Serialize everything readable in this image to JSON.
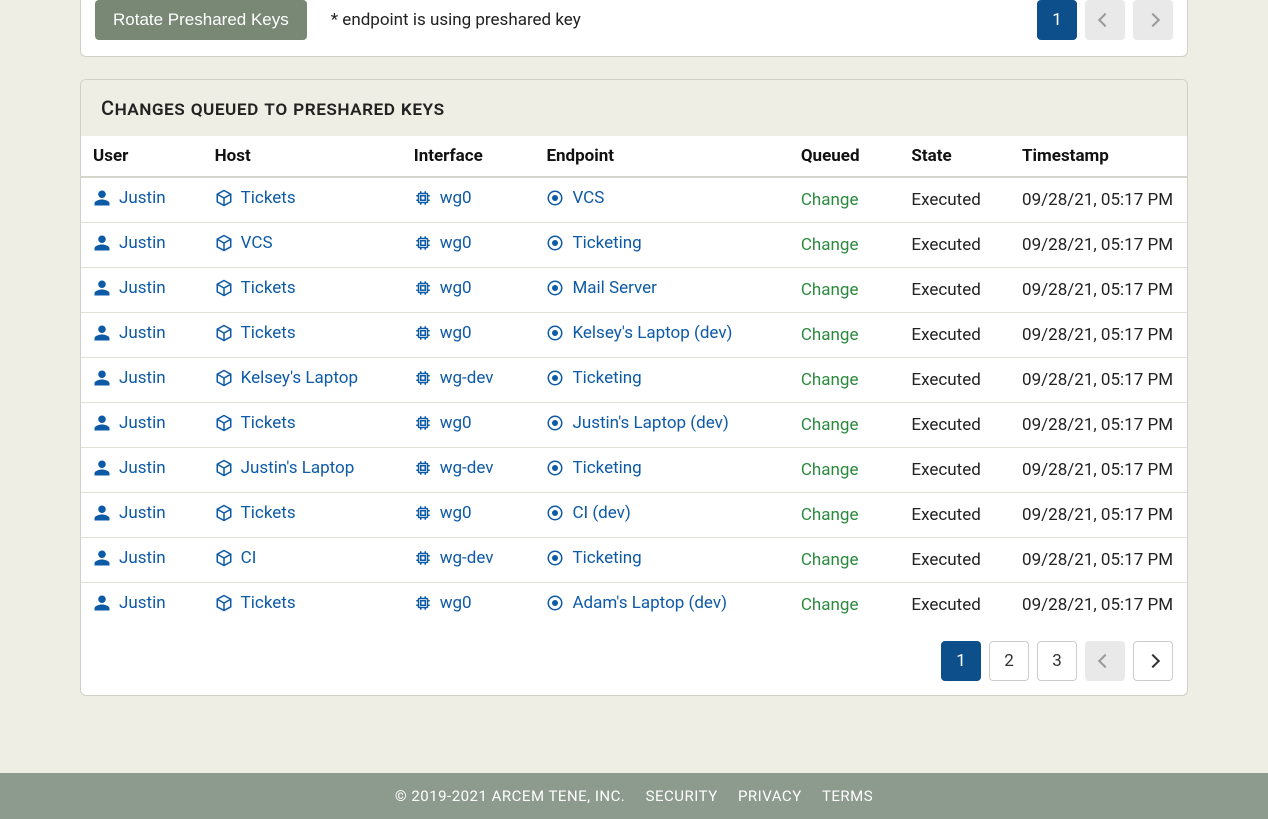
{
  "top": {
    "rotate_label": "Rotate Preshared Keys",
    "pk_note": "* endpoint is using preshared key",
    "pager": {
      "pages": [
        "1"
      ],
      "active": "1",
      "prev_enabled": false,
      "next_enabled": false
    }
  },
  "changes": {
    "title": "CHANGES QUEUED TO PRESHARED KEYS",
    "headers": {
      "user": "User",
      "host": "Host",
      "interface": "Interface",
      "endpoint": "Endpoint",
      "queued": "Queued",
      "state": "State",
      "timestamp": "Timestamp"
    },
    "rows": [
      {
        "user": "Justin",
        "host": "Tickets",
        "interface": "wg0",
        "endpoint": "VCS",
        "queued": "Change",
        "state": "Executed",
        "timestamp": "09/28/21, 05:17 PM"
      },
      {
        "user": "Justin",
        "host": "VCS",
        "interface": "wg0",
        "endpoint": "Ticketing",
        "queued": "Change",
        "state": "Executed",
        "timestamp": "09/28/21, 05:17 PM"
      },
      {
        "user": "Justin",
        "host": "Tickets",
        "interface": "wg0",
        "endpoint": "Mail Server",
        "queued": "Change",
        "state": "Executed",
        "timestamp": "09/28/21, 05:17 PM"
      },
      {
        "user": "Justin",
        "host": "Tickets",
        "interface": "wg0",
        "endpoint": "Kelsey's Laptop (dev)",
        "queued": "Change",
        "state": "Executed",
        "timestamp": "09/28/21, 05:17 PM"
      },
      {
        "user": "Justin",
        "host": "Kelsey's Laptop",
        "interface": "wg-dev",
        "endpoint": "Ticketing",
        "queued": "Change",
        "state": "Executed",
        "timestamp": "09/28/21, 05:17 PM"
      },
      {
        "user": "Justin",
        "host": "Tickets",
        "interface": "wg0",
        "endpoint": "Justin's Laptop (dev)",
        "queued": "Change",
        "state": "Executed",
        "timestamp": "09/28/21, 05:17 PM"
      },
      {
        "user": "Justin",
        "host": "Justin's Laptop",
        "interface": "wg-dev",
        "endpoint": "Ticketing",
        "queued": "Change",
        "state": "Executed",
        "timestamp": "09/28/21, 05:17 PM"
      },
      {
        "user": "Justin",
        "host": "Tickets",
        "interface": "wg0",
        "endpoint": "CI (dev)",
        "queued": "Change",
        "state": "Executed",
        "timestamp": "09/28/21, 05:17 PM"
      },
      {
        "user": "Justin",
        "host": "CI",
        "interface": "wg-dev",
        "endpoint": "Ticketing",
        "queued": "Change",
        "state": "Executed",
        "timestamp": "09/28/21, 05:17 PM"
      },
      {
        "user": "Justin",
        "host": "Tickets",
        "interface": "wg0",
        "endpoint": "Adam's Laptop (dev)",
        "queued": "Change",
        "state": "Executed",
        "timestamp": "09/28/21, 05:17 PM"
      }
    ],
    "pager": {
      "pages": [
        "1",
        "2",
        "3"
      ],
      "active": "1",
      "prev_enabled": false,
      "next_enabled": true
    }
  },
  "footer": {
    "copyright": "© 2019-2021 ARCEM TENE, INC.",
    "links": {
      "security": "SECURITY",
      "privacy": "PRIVACY",
      "terms": "TERMS"
    }
  }
}
